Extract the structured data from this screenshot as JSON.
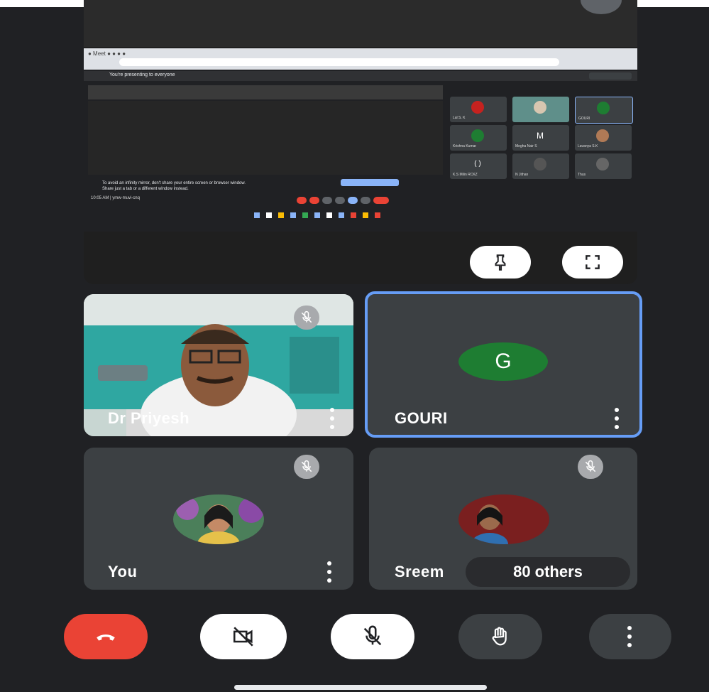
{
  "presentation": {
    "banner_text": "You're presenting to everyone",
    "warning_text": "To avoid an infinity mirror, don't share your entire screen or browser window. Share just a tab or a different window instead.",
    "clock_text": "10:05 AM | ymw-muvi-cnq",
    "mini_tiles": [
      "Lal S. K",
      "",
      "GOURI",
      "Krishna Kumar",
      "Megha Nair S",
      "Lavanya S.K",
      "K.S Milin RCKZ",
      "N Jithan",
      "Thus"
    ]
  },
  "participants": {
    "priyesh": {
      "name": "Dr Priyesh",
      "muted": true
    },
    "gouri": {
      "name": "GOURI",
      "initial": "G",
      "avatar_color": "#1e7d32",
      "active_speaker_border": "#669df6"
    },
    "you": {
      "name": "You",
      "muted": true
    },
    "sreem": {
      "name": "Sreem",
      "muted": true
    }
  },
  "others_chip": "80 others",
  "controls": {
    "end_call_color": "#ea4335"
  }
}
